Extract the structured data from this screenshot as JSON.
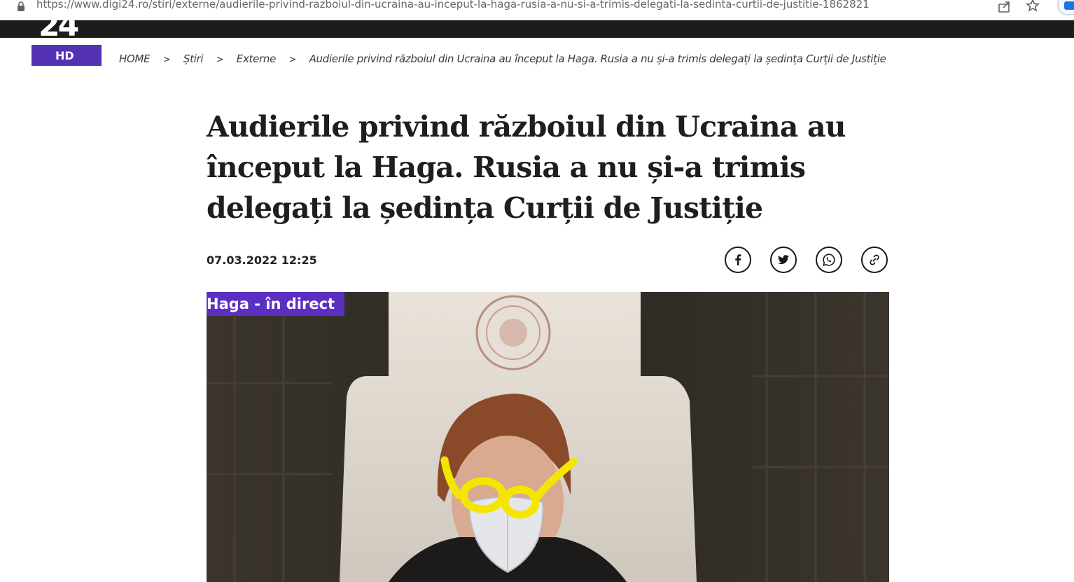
{
  "browser": {
    "url": "https://www.digi24.ro/stiri/externe/audierile-privind-razboiul-din-ucraina-au-inceput-la-haga-rusia-a-nu-si-a-trimis-delegati-la-sedinta-curtii-de-justitie-1862821"
  },
  "site": {
    "logo_number": "24",
    "logo_hd": "HD"
  },
  "breadcrumb": {
    "items": [
      "HOME",
      "Știri",
      "Externe"
    ],
    "current": "Audierile privind războiul din Ucraina au început la Haga. Rusia a nu și-a trimis delegați la ședința Curții de Justiție",
    "separator": ">"
  },
  "article": {
    "title": "Audierile privind războiul din Ucraina au început la Haga. Rusia a nu și-a trimis delegați la ședința Curții de Justiție",
    "date": "07.03.2022 12:25"
  },
  "share": {
    "icons": [
      "facebook-icon",
      "twitter-icon",
      "whatsapp-icon",
      "link-icon"
    ]
  },
  "media": {
    "live_tag": "Haga - în direct",
    "overlay_color": "#f5e600"
  }
}
